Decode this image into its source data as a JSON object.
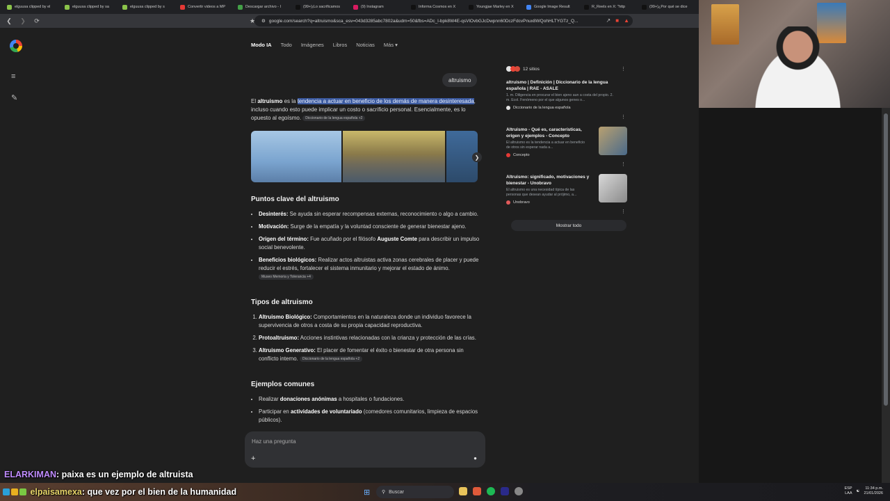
{
  "browser": {
    "tabs": [
      {
        "label": "elguusa clipped by el",
        "color": "#8bc34a"
      },
      {
        "label": "elguusa clipped by sa",
        "color": "#8bc34a"
      },
      {
        "label": "elguusa clipped by s",
        "color": "#8bc34a"
      },
      {
        "label": "Convertir videos a MP",
        "color": "#e53935"
      },
      {
        "label": "Descargar archivo - I",
        "color": "#43a047"
      },
      {
        "label": "(99+)¡Lo sacrificamos",
        "color": "#111111"
      },
      {
        "label": "(9) Instagram",
        "color": "#d81b60"
      },
      {
        "label": "Informa Cosmos en X",
        "color": "#111111"
      },
      {
        "label": "Youngjae Marley en X",
        "color": "#111111"
      },
      {
        "label": "Google Image Result",
        "color": "#4285f4"
      },
      {
        "label": "R_Reels en X: \"http",
        "color": "#111111"
      },
      {
        "label": "(99+)¿Por qué se dice",
        "color": "#111111"
      }
    ],
    "url": "google.com/search?q=altruismo&sca_esv=043d3285abc7802a&udm=50&fbs=ADc_l-bpk8W4E-qsVlOvbGJcDwpnn60DczFdcvPnux8WQohHLTYGTz_Q..."
  },
  "search": {
    "modes": [
      "Modo IA",
      "Todo",
      "Imágenes",
      "Libros",
      "Noticias",
      "Más"
    ],
    "query": "altruismo"
  },
  "answer": {
    "p1_a": "El ",
    "p1_b": "altruismo",
    "p1_c": " es la ",
    "p1_hl": "tendencia a actuar en beneficio de los demás de manera desinteresada",
    "p1_d": ", incluso cuando esto puede implicar un costo o sacrificio personal. Esencialmente, es lo opuesto al egoísmo.",
    "p1_chip": "Diccionario de la lengua española +2"
  },
  "section1": {
    "title": "Puntos clave del altruismo",
    "items": [
      {
        "b": "Desinterés:",
        "t": " Se ayuda sin esperar recompensas externas, reconocimiento o algo a cambio."
      },
      {
        "b": "Motivación:",
        "t": " Surge de la empatía y la voluntad consciente de generar bienestar ajeno."
      },
      {
        "b": "Origen del término:",
        "t": " Fue acuñado por el filósofo ",
        "b2": "Auguste Comte",
        "t2": " para describir un impulso social benevolente."
      },
      {
        "b": "Beneficios biológicos:",
        "t": " Realizar actos altruistas activa zonas cerebrales de placer y puede reducir el estrés, fortalecer el sistema inmunitario y mejorar el estado de ánimo.",
        "chip": "Museo Memoria y Tolerancia +4"
      }
    ]
  },
  "section2": {
    "title": "Tipos de altruismo",
    "items": [
      {
        "b": "Altruismo Biológico:",
        "t": " Comportamientos en la naturaleza donde un individuo favorece la supervivencia de otros a costa de su propia capacidad reproductiva."
      },
      {
        "b": "Protoaltruismo:",
        "t": " Acciones instintivas relacionadas con la crianza y protección de las crías."
      },
      {
        "b": "Altruismo Generativo:",
        "t": " El placer de fomentar el éxito o bienestar de otra persona sin conflicto interno.",
        "chip": "Diccionario de la lengua española +2"
      }
    ]
  },
  "section3": {
    "title": "Ejemplos comunes",
    "items": [
      {
        "t": "Realizar ",
        "b": "donaciones anónimas",
        "t2": " a hospitales o fundaciones."
      },
      {
        "t": "Participar en ",
        "b": "actividades de voluntariado",
        "t2": " (comedores comunitarios, limpieza de espacios públicos)."
      }
    ]
  },
  "askbar": {
    "placeholder": "Haz una pregunta"
  },
  "sources": {
    "count_label": "12 sitios",
    "items": [
      {
        "title": "altruismo | Definición | Diccionario de la lengua española | RAE - ASALE",
        "snippet": "1. m. Diligencia en procurar el bien ajeno aun a costa del propio. 2. m. Ecol. Fenómeno por el que algunos genes o...",
        "site": "Diccionario de la lengua española"
      },
      {
        "title": "Altruismo - Qué es, características, origen y ejemplos - Concepto",
        "snippet": "El altruismo es la tendencia a actuar en beneficio de otros sin esperar nada a...",
        "site": "Concepto"
      },
      {
        "title": "Altruismo: significado, motivaciones y bienestar - Unobravo",
        "snippet": "El altruismo es una necesidad típica de las personas que desean ayudar al prójimo, a...",
        "site": "Unobravo"
      }
    ],
    "show_all": "Mostrar todo"
  },
  "chat": [
    {
      "user": "ELARKIMAN",
      "msg": ": paixa es un ejemplo de altruista"
    },
    {
      "user": "elpaisamexa",
      "msg": ": que vez por el bien de la humanidad"
    }
  ],
  "taskbar": {
    "search": "Buscar",
    "lang": "ESP",
    "lang2": "LAA",
    "time": "11:34 p.m.",
    "date": "21/01/2026"
  }
}
